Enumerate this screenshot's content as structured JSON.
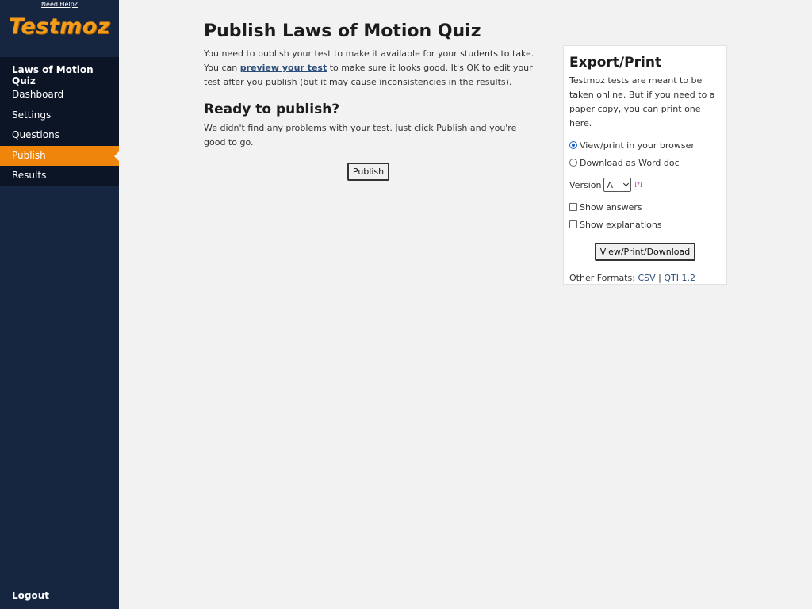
{
  "sidebar": {
    "need_help": "Need Help?",
    "logo": "Testmoz",
    "quiz_title": "Laws of Motion Quiz",
    "items": [
      {
        "label": "Dashboard"
      },
      {
        "label": "Settings"
      },
      {
        "label": "Questions"
      },
      {
        "label": "Publish"
      },
      {
        "label": "Results"
      }
    ],
    "logout": "Logout"
  },
  "main": {
    "title": "Publish Laws of Motion Quiz",
    "intro_1": "You need to publish your test to make it available for your students to take. You can ",
    "preview_link": "preview your test",
    "intro_2": " to make sure it looks good. It's OK to edit your test after you publish (but it may cause inconsistencies in the results).",
    "ready_heading": "Ready to publish?",
    "ready_text": "We didn't find any problems with your test. Just click Publish and you're good to go.",
    "publish_button": "Publish"
  },
  "export": {
    "title": "Export/Print",
    "description": "Testmoz tests are meant to be taken online. But if you need to a paper copy, you can print one here.",
    "option_browser": "View/print in your browser",
    "option_word": "Download as Word doc",
    "version_label": "Version",
    "version_value": "A",
    "help": "[?]",
    "show_answers": "Show answers",
    "show_explanations": "Show explanations",
    "button": "View/Print/Download",
    "other_formats_label": "Other Formats: ",
    "csv": "CSV",
    "separator": " | ",
    "qti": "QTI 1.2"
  }
}
